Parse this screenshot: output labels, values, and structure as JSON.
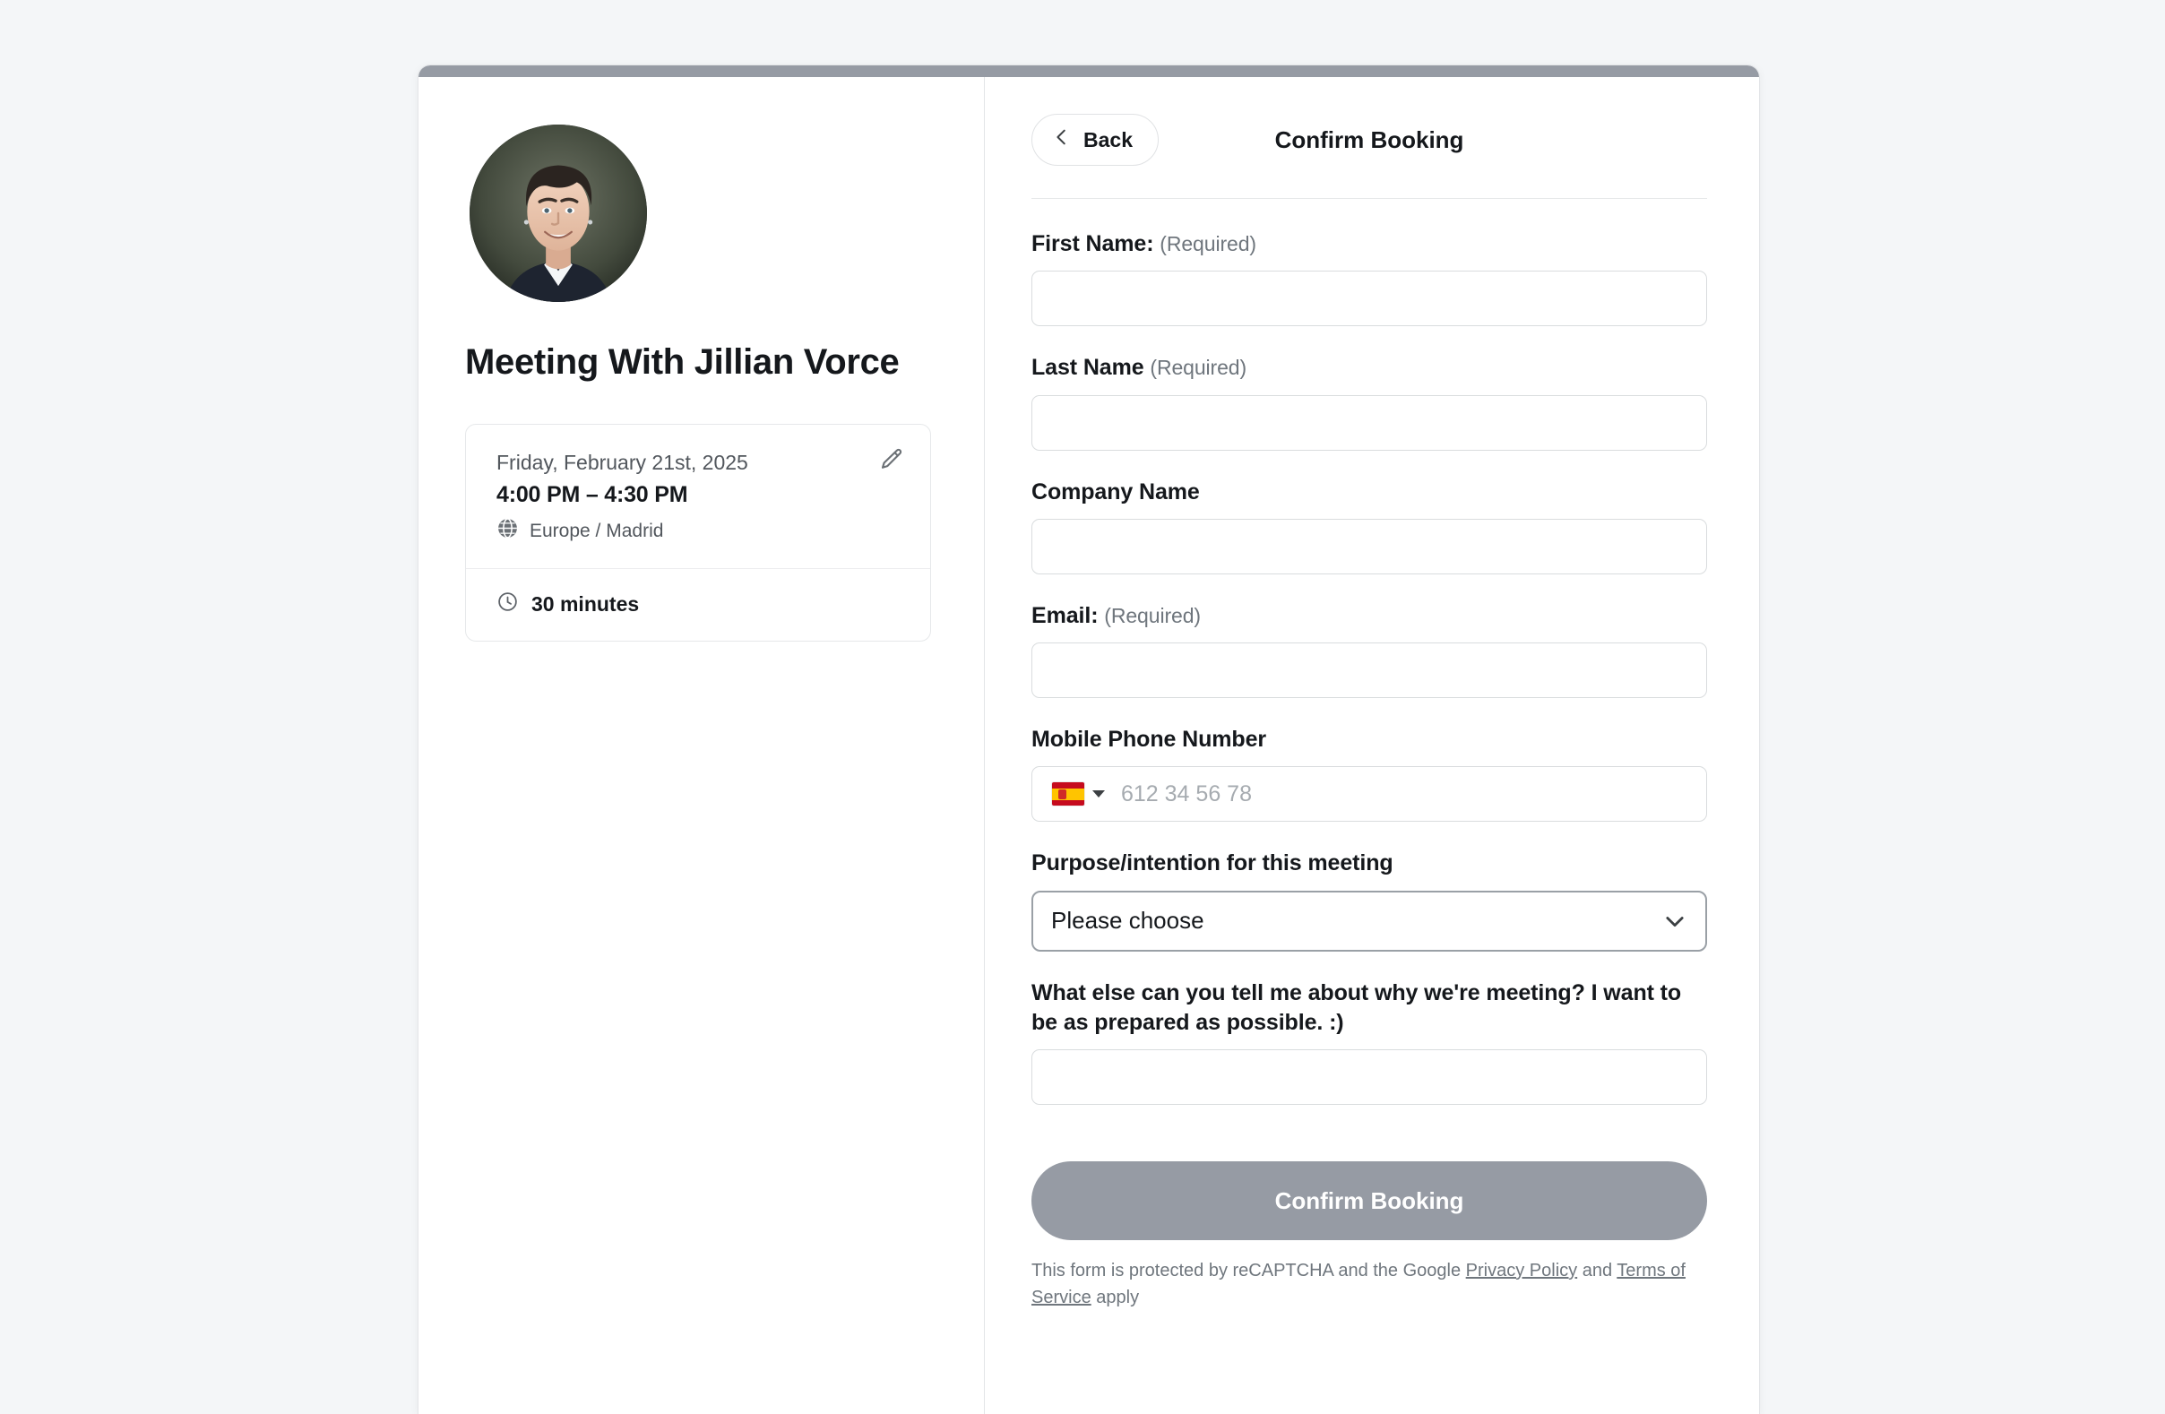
{
  "left": {
    "avatar_alt": "Jillian Vorce headshot",
    "meeting_title": "Meeting With Jillian Vorce",
    "detail": {
      "date": "Friday, February 21st, 2025",
      "time_range": "4:00 PM – 4:30 PM",
      "timezone": "Europe / Madrid",
      "duration": "30 minutes",
      "edit_icon": "pencil-icon",
      "globe_icon": "globe-icon",
      "clock_icon": "clock-icon"
    }
  },
  "right": {
    "back_label": "Back",
    "back_icon": "chevron-left-icon",
    "title": "Confirm Booking",
    "fields": {
      "first_name": {
        "label": "First Name:",
        "required_note": "(Required)",
        "value": "",
        "placeholder": ""
      },
      "last_name": {
        "label": "Last Name",
        "required_note": "(Required)",
        "value": "",
        "placeholder": ""
      },
      "company_name": {
        "label": "Company Name",
        "required_note": "",
        "value": "",
        "placeholder": ""
      },
      "email": {
        "label": "Email:",
        "required_note": "(Required)",
        "value": "",
        "placeholder": ""
      },
      "phone": {
        "label": "Mobile Phone Number",
        "value": "",
        "placeholder": "612 34 56 78",
        "country_flag": "spain-flag-icon",
        "caret_icon": "caret-down-icon"
      },
      "purpose": {
        "label": "Purpose/intention for this meeting",
        "selected": "Please choose",
        "chevron_icon": "chevron-down-icon"
      },
      "notes": {
        "label": "What else can you tell me about why we're meeting? I want to be as prepared as possible. :)",
        "value": "",
        "placeholder": ""
      }
    },
    "submit_label": "Confirm Booking",
    "recaptcha": {
      "prefix": "This form is protected by reCAPTCHA and the Google ",
      "privacy_link": "Privacy Policy",
      "middle": " and ",
      "terms_link": "Terms of Service",
      "suffix": " apply"
    }
  },
  "colors": {
    "page_background": "#f4f6f8",
    "card_topbar": "#969ba4",
    "submit_button": "#969ba4",
    "text_primary": "#15181c",
    "text_muted": "#6f767d",
    "border": "#d9dcde",
    "select_border": "#9aa0a6"
  }
}
